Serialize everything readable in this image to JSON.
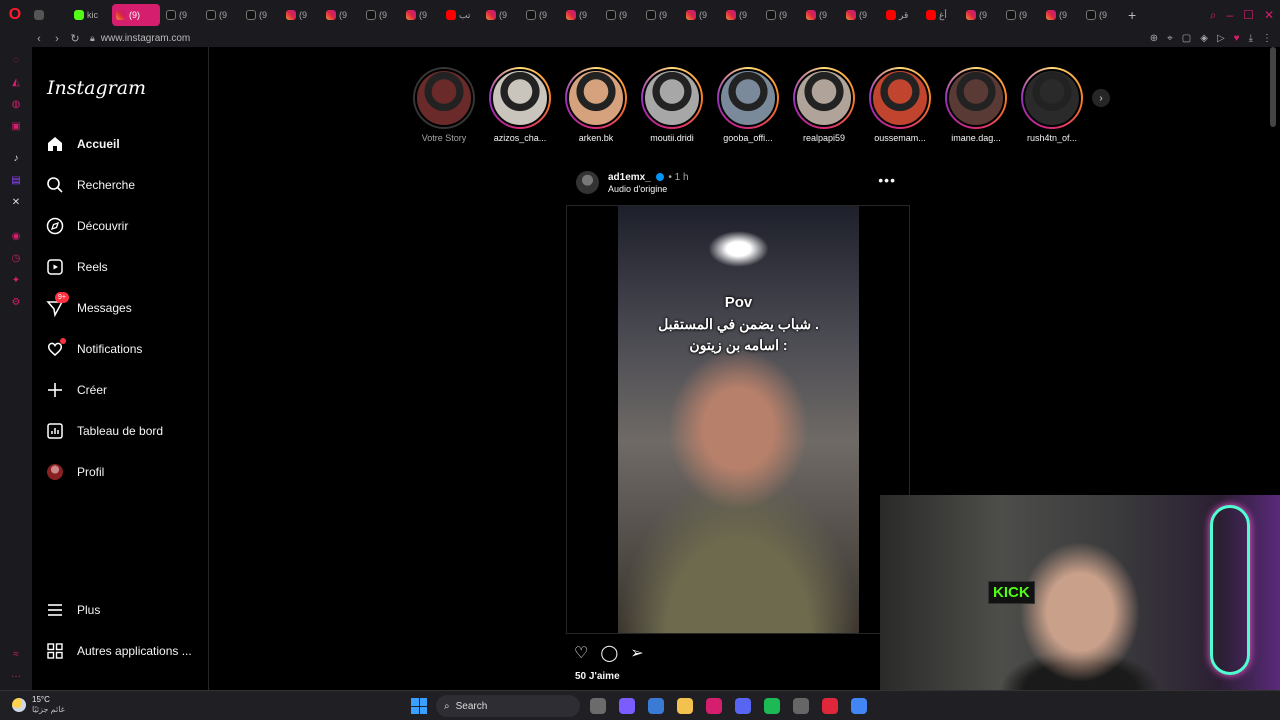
{
  "browser": {
    "tabs": [
      {
        "fav": "ws",
        "label": ""
      },
      {
        "fav": "kk",
        "label": "kic"
      },
      {
        "fav": "ig",
        "label": "(9)",
        "active": true
      },
      {
        "fav": "tt",
        "label": "(9"
      },
      {
        "fav": "tt",
        "label": "(9"
      },
      {
        "fav": "tt",
        "label": "(9"
      },
      {
        "fav": "ig",
        "label": "(9"
      },
      {
        "fav": "ig",
        "label": "(9"
      },
      {
        "fav": "tt",
        "label": "(9"
      },
      {
        "fav": "ig",
        "label": "(9"
      },
      {
        "fav": "yt",
        "label": "تب"
      },
      {
        "fav": "ig",
        "label": "(9"
      },
      {
        "fav": "tt",
        "label": "(9"
      },
      {
        "fav": "ig",
        "label": "(9"
      },
      {
        "fav": "tt",
        "label": "(9"
      },
      {
        "fav": "tt",
        "label": "(9"
      },
      {
        "fav": "ig",
        "label": "(9"
      },
      {
        "fav": "ig",
        "label": "(9"
      },
      {
        "fav": "tt",
        "label": "(9"
      },
      {
        "fav": "ig",
        "label": "(9"
      },
      {
        "fav": "ig",
        "label": "(9"
      },
      {
        "fav": "yt",
        "label": "قر"
      },
      {
        "fav": "yt",
        "label": "أغ"
      },
      {
        "fav": "ig",
        "label": "(9"
      },
      {
        "fav": "tt",
        "label": "(9"
      },
      {
        "fav": "ig",
        "label": "(9"
      },
      {
        "fav": "tt",
        "label": "(9"
      }
    ],
    "url": "www.instagram.com"
  },
  "instagram": {
    "logo": "Instagram",
    "nav": [
      {
        "id": "home",
        "label": "Accueil",
        "icon": "home-icon",
        "bold": true
      },
      {
        "id": "search",
        "label": "Recherche",
        "icon": "search-icon"
      },
      {
        "id": "explore",
        "label": "Découvrir",
        "icon": "compass-icon"
      },
      {
        "id": "reels",
        "label": "Reels",
        "icon": "reels-icon"
      },
      {
        "id": "messages",
        "label": "Messages",
        "icon": "messenger-icon",
        "badge": "9+"
      },
      {
        "id": "notifications",
        "label": "Notifications",
        "icon": "heart-icon",
        "dot": true
      },
      {
        "id": "create",
        "label": "Créer",
        "icon": "plus-icon"
      },
      {
        "id": "dashboard",
        "label": "Tableau de bord",
        "icon": "dashboard-icon"
      },
      {
        "id": "profile",
        "label": "Profil",
        "icon": "avatar-icon"
      }
    ],
    "nav_bottom": [
      {
        "id": "more",
        "label": "Plus",
        "icon": "menu-icon"
      },
      {
        "id": "apps",
        "label": "Autres applications ...",
        "icon": "apps-icon"
      }
    ],
    "stories": [
      {
        "name": "Votre Story",
        "own": true,
        "tone": "#6b2a2a"
      },
      {
        "name": "azizos_cha...",
        "tone": "#c9c4bc"
      },
      {
        "name": "arken.bk",
        "tone": "#d6a27e"
      },
      {
        "name": "moutii.dridi",
        "tone": "#a7a7a7"
      },
      {
        "name": "gooba_offi...",
        "tone": "#7a8a9a"
      },
      {
        "name": "realpapi59",
        "tone": "#b0a49a"
      },
      {
        "name": "oussemam...",
        "tone": "#c0442e"
      },
      {
        "name": "imane.dag...",
        "tone": "#5a3a35"
      },
      {
        "name": "rush4tn_of...",
        "tone": "#2a2a2a"
      }
    ],
    "post": {
      "username": "ad1emx_",
      "time": "1 h",
      "audio": "Audio d'origine",
      "overlay_lines": [
        "Pov",
        "شباب يضمن في المستقبل .",
        "اسامه بن زيتون :"
      ],
      "likes": "50 J'aime"
    }
  },
  "webcam": {
    "sign": "KICK"
  },
  "taskbar": {
    "weather_temp": "15°C",
    "weather_cond": "غائم جزئيًا",
    "search_label": "Search",
    "apps": [
      {
        "name": "file-manager-icon",
        "color": "#6b6b6b"
      },
      {
        "name": "copilot-icon",
        "color": "#7a5cff"
      },
      {
        "name": "store-icon",
        "color": "#3a7bd5"
      },
      {
        "name": "folder-icon",
        "color": "#f2c14e"
      },
      {
        "name": "opera-icon",
        "color": "#d51e6e"
      },
      {
        "name": "discord-icon",
        "color": "#5865f2"
      },
      {
        "name": "spotify-icon",
        "color": "#1db954"
      },
      {
        "name": "steam-icon",
        "color": "#666"
      },
      {
        "name": "app-red-icon",
        "color": "#e0263a"
      },
      {
        "name": "chrome-icon",
        "color": "#4285f4"
      }
    ]
  }
}
